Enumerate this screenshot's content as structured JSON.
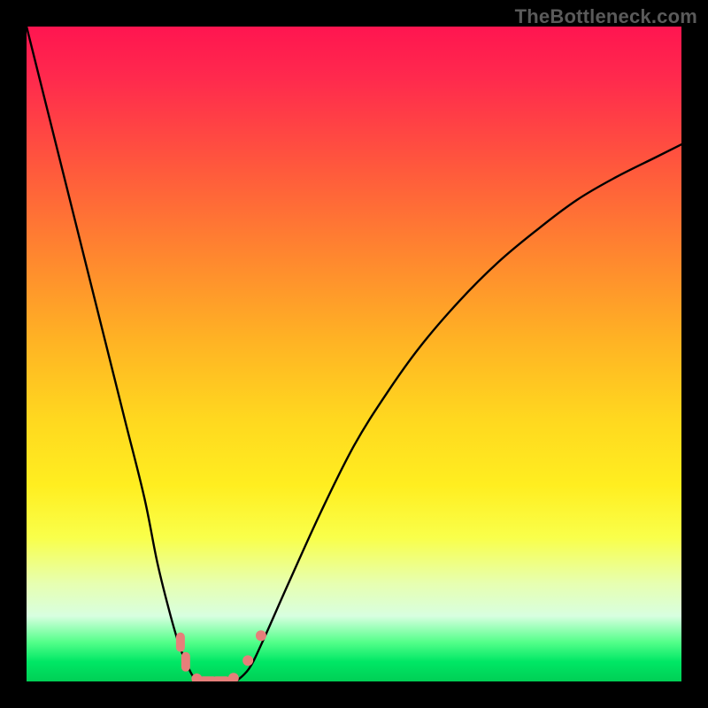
{
  "watermark": {
    "text": "TheBottleneck.com"
  },
  "colors": {
    "frame": "#000000",
    "curve": "#000000",
    "marker": "#e77f7a",
    "gradient_stops": [
      "#ff1550",
      "#ff2a4d",
      "#ff5a3c",
      "#ff8a2e",
      "#ffb324",
      "#ffd81f",
      "#ffee20",
      "#f9ff4a",
      "#e7ffb0",
      "#d8ffe0",
      "#54ff8a",
      "#00e765",
      "#00cf55"
    ]
  },
  "chart_data": {
    "type": "line",
    "title": "",
    "xlabel": "",
    "ylabel": "",
    "xlim": [
      0,
      100
    ],
    "ylim": [
      0,
      100
    ],
    "grid": false,
    "legend": false,
    "series": [
      {
        "name": "left-branch",
        "x": [
          0,
          3,
          6,
          9,
          12,
          15,
          18,
          20,
          22,
          23.5,
          25,
          26
        ],
        "y": [
          100,
          88,
          76,
          64,
          52,
          40,
          28,
          18,
          10,
          5,
          1.5,
          0
        ]
      },
      {
        "name": "right-branch",
        "x": [
          32,
          34,
          36,
          40,
          45,
          50,
          55,
          60,
          66,
          72,
          78,
          84,
          90,
          96,
          100
        ],
        "y": [
          0,
          2,
          6,
          15,
          26,
          36,
          44,
          51,
          58,
          64,
          69,
          73.5,
          77,
          80,
          82
        ]
      },
      {
        "name": "valley-floor",
        "x": [
          26,
          27.5,
          29,
          30.5,
          32
        ],
        "y": [
          0,
          0,
          0,
          0,
          0
        ]
      }
    ],
    "markers": [
      {
        "shape": "vcap",
        "x": 23.5,
        "y": 6
      },
      {
        "shape": "vcap",
        "x": 24.3,
        "y": 3
      },
      {
        "shape": "dot",
        "x": 26.0,
        "y": 0.4
      },
      {
        "shape": "hcap",
        "x": 27.7,
        "y": 0.1
      },
      {
        "shape": "hcap",
        "x": 29.7,
        "y": 0.1
      },
      {
        "shape": "dot",
        "x": 31.6,
        "y": 0.5
      },
      {
        "shape": "dot",
        "x": 33.8,
        "y": 3.2
      },
      {
        "shape": "dot",
        "x": 35.8,
        "y": 7.0
      }
    ]
  }
}
